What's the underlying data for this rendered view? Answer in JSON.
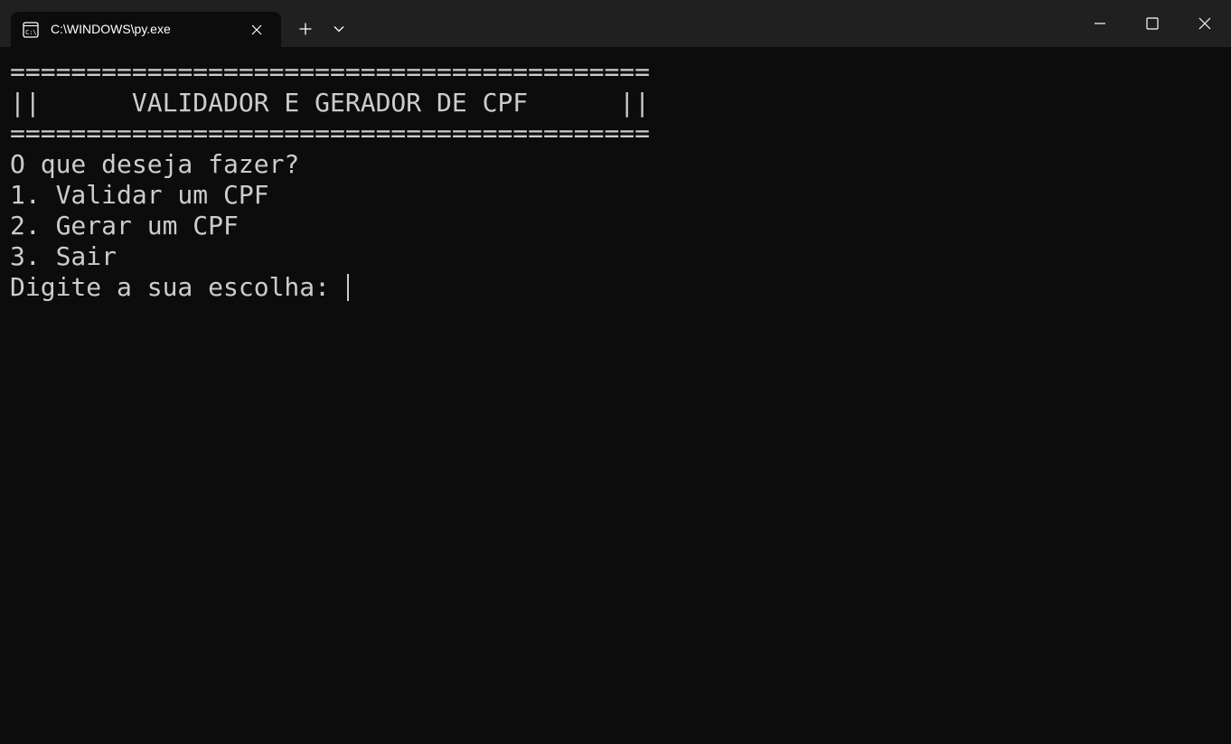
{
  "window": {
    "tab_title": "C:\\WINDOWS\\py.exe",
    "tab_icon": "terminal-icon",
    "new_tab_icon": "plus-icon",
    "dropdown_icon": "chevron-down-icon",
    "controls": [
      "minimize-icon",
      "maximize-icon",
      "close-icon"
    ]
  },
  "terminal": {
    "lines": [
      "==========================================",
      "||      VALIDADOR E GERADOR DE CPF      ||",
      "==========================================",
      "O que deseja fazer?",
      "1. Validar um CPF",
      "2. Gerar um CPF",
      "3. Sair",
      "Digite a sua escolha: "
    ]
  },
  "colors": {
    "background": "#0c0c0c",
    "titlebar": "#202020",
    "text": "#cccccc"
  }
}
